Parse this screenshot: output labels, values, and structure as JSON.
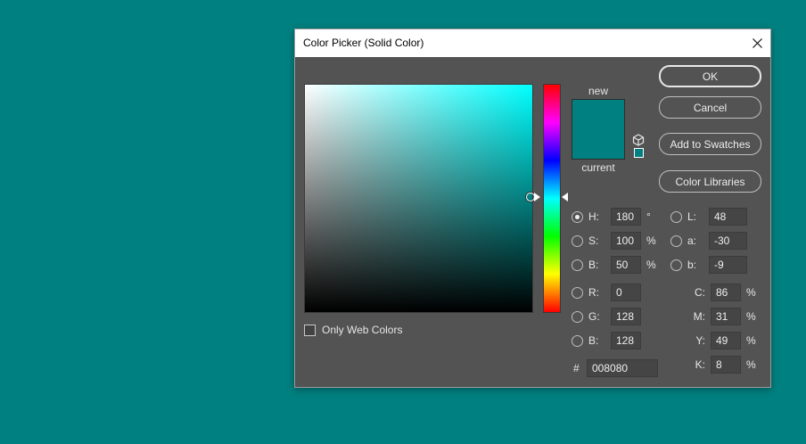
{
  "window": {
    "title": "Color Picker (Solid Color)"
  },
  "colors": {
    "background": "#008080",
    "new": "#008080",
    "current": "#008080",
    "hue_marker": "#00ffff"
  },
  "icons": {
    "close": "close-icon",
    "cube": "cube-icon",
    "websafe": "web-safe-swatch-icon"
  },
  "buttons": {
    "ok": "OK",
    "cancel": "Cancel",
    "add_swatches": "Add to Swatches",
    "color_libraries": "Color Libraries"
  },
  "preview": {
    "new_label": "new",
    "current_label": "current"
  },
  "only_web_colors": {
    "label": "Only Web Colors",
    "checked": false
  },
  "hsb": [
    {
      "label": "H:",
      "value": "180",
      "unit": "°",
      "selected": true
    },
    {
      "label": "S:",
      "value": "100",
      "unit": "%",
      "selected": false
    },
    {
      "label": "B:",
      "value": "50",
      "unit": "%",
      "selected": false
    }
  ],
  "rgb": [
    {
      "label": "R:",
      "value": "0"
    },
    {
      "label": "G:",
      "value": "128"
    },
    {
      "label": "B:",
      "value": "128"
    }
  ],
  "lab": [
    {
      "label": "L:",
      "value": "48"
    },
    {
      "label": "a:",
      "value": "-30"
    },
    {
      "label": "b:",
      "value": "-9"
    }
  ],
  "cmyk": [
    {
      "label": "C:",
      "value": "86",
      "unit": "%"
    },
    {
      "label": "M:",
      "value": "31",
      "unit": "%"
    },
    {
      "label": "Y:",
      "value": "49",
      "unit": "%"
    },
    {
      "label": "K:",
      "value": "8",
      "unit": "%"
    }
  ],
  "hex": {
    "label": "#",
    "value": "008080"
  }
}
